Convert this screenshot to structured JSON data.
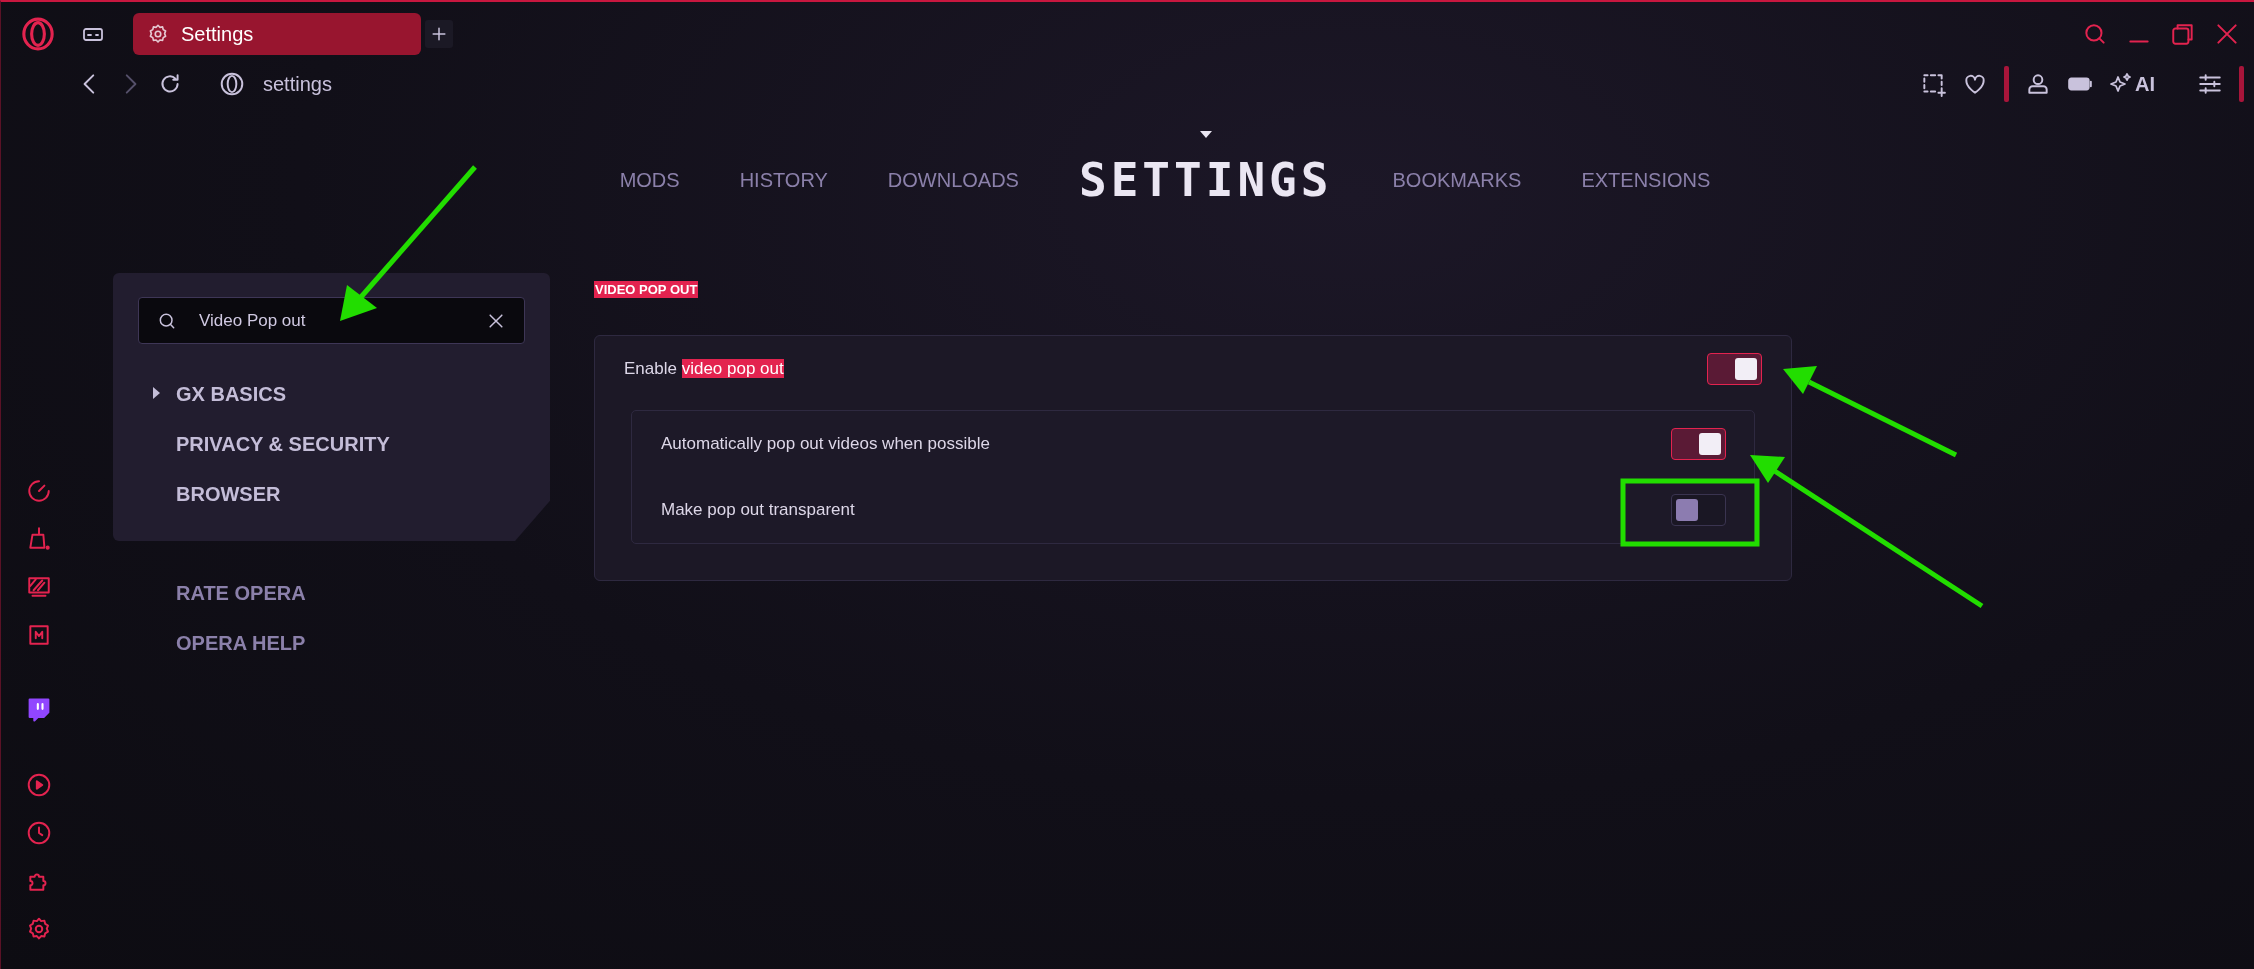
{
  "tabs": [
    {
      "label": "Settings",
      "selected": true
    }
  ],
  "address": {
    "value": "settings"
  },
  "toolbar": {
    "ai_label": "AI"
  },
  "nav": [
    {
      "label": "MODS",
      "selected": false
    },
    {
      "label": "HISTORY",
      "selected": false
    },
    {
      "label": "DOWNLOADS",
      "selected": false
    },
    {
      "label": "SETTINGS",
      "selected": true
    },
    {
      "label": "BOOKMARKS",
      "selected": false
    },
    {
      "label": "EXTENSIONS",
      "selected": false
    }
  ],
  "search": {
    "value": "Video Pop out"
  },
  "sidebar": {
    "items": [
      {
        "label": "GX BASICS",
        "expandable": true
      },
      {
        "label": "PRIVACY & SECURITY",
        "expandable": false
      },
      {
        "label": "BROWSER",
        "expandable": false
      }
    ],
    "links": [
      "RATE OPERA",
      "OPERA HELP"
    ]
  },
  "section": {
    "title": "VIDEO POP OUT",
    "setting": {
      "label": "Enable ",
      "match": "video pop out",
      "on": true
    },
    "subsettings": [
      {
        "label": "Automatically pop out videos when possible",
        "on": true
      },
      {
        "label": "Make pop out transparent",
        "on": false
      }
    ]
  }
}
